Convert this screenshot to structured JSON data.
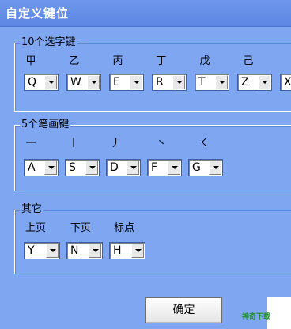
{
  "window": {
    "title": "自定义键位"
  },
  "group1": {
    "title": "10个选字键",
    "labels": [
      "甲",
      "乙",
      "丙",
      "丁",
      "戊",
      "己"
    ],
    "keys": [
      "Q",
      "W",
      "E",
      "R",
      "T",
      "Z",
      "X"
    ]
  },
  "group2": {
    "title": "5个笔画键",
    "labels": [
      "一",
      "丨",
      "丿",
      "丶",
      "㇛"
    ],
    "keys": [
      "A",
      "S",
      "D",
      "F",
      "G"
    ]
  },
  "group3": {
    "title": "其它",
    "labels": [
      "上页",
      "下页",
      "标点"
    ],
    "keys": [
      "Y",
      "N",
      "H"
    ]
  },
  "ok_label": "确定",
  "watermark": "神奇下载"
}
